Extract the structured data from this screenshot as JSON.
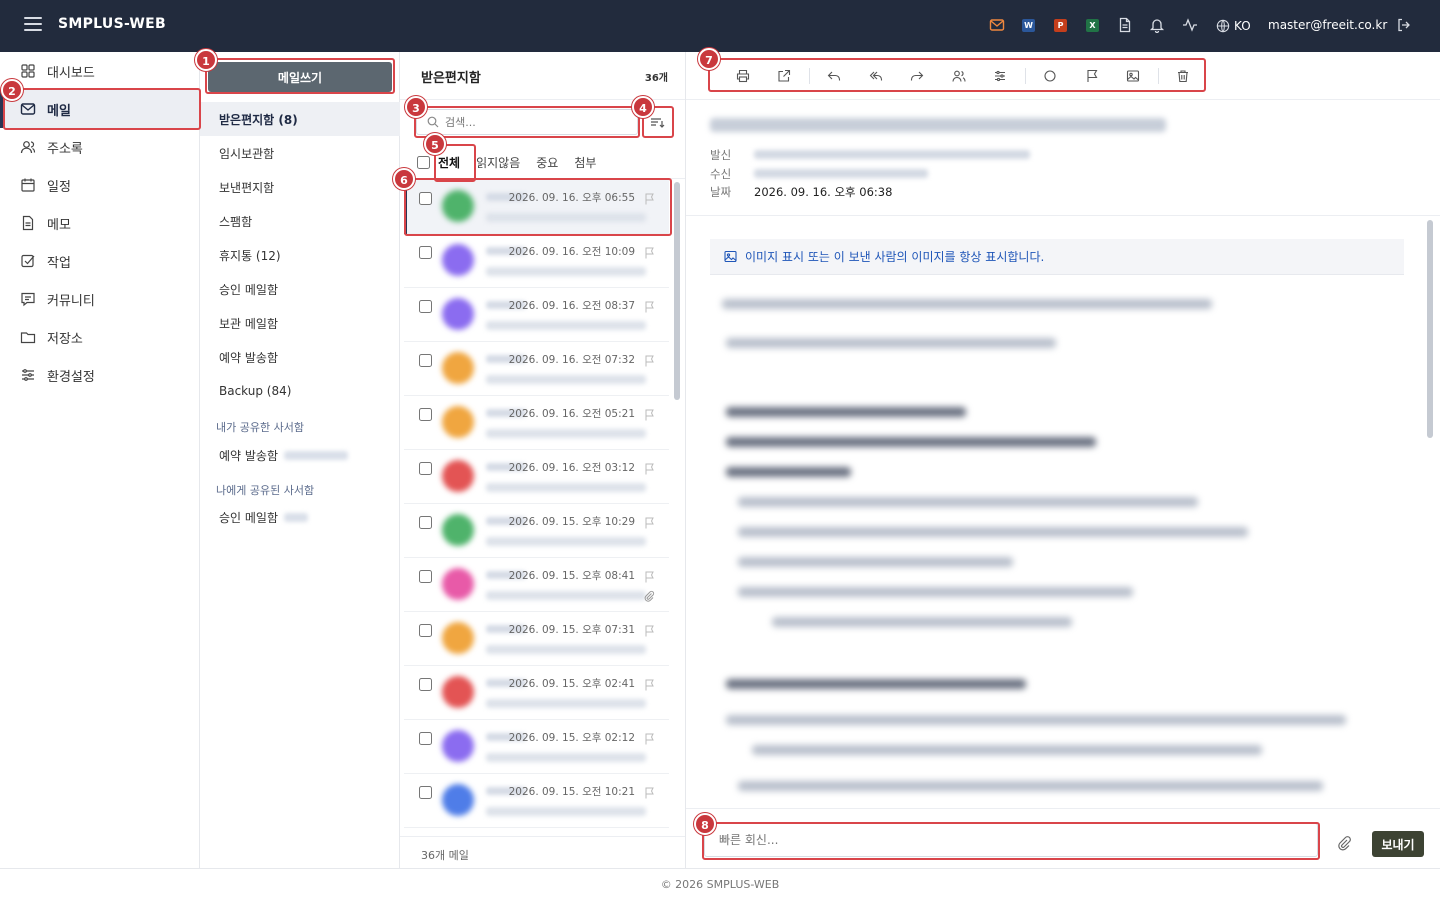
{
  "app": {
    "brand": "SMPLUS-WEB",
    "lang": "KO",
    "user_email": "master@freeit.co.kr",
    "footer": "© 2026 SMPLUS-WEB"
  },
  "topbar_icons": [
    "mail-icon",
    "word-icon",
    "powerpoint-icon",
    "excel-icon",
    "document-icon",
    "bell-icon",
    "activity-icon",
    "globe-icon",
    "logout-icon"
  ],
  "office_letters": {
    "word": "W",
    "powerpoint": "P",
    "excel": "X"
  },
  "colors": {
    "topbar": "#222b3d",
    "accent": "#2a3553",
    "annotation": "#d9454a",
    "word": "#2b579a",
    "powerpoint": "#c43e1c",
    "excel": "#217346",
    "mail_icon": "#f0883e"
  },
  "sidebar": {
    "items": [
      {
        "label": "대시보드",
        "icon": "grid-icon"
      },
      {
        "label": "메일",
        "icon": "mail-icon",
        "active": true
      },
      {
        "label": "주소록",
        "icon": "contacts-icon"
      },
      {
        "label": "일정",
        "icon": "calendar-icon"
      },
      {
        "label": "메모",
        "icon": "memo-icon"
      },
      {
        "label": "작업",
        "icon": "task-icon"
      },
      {
        "label": "커뮤니티",
        "icon": "community-icon"
      },
      {
        "label": "저장소",
        "icon": "folder-icon"
      },
      {
        "label": "환경설정",
        "icon": "settings-icon"
      }
    ]
  },
  "folders": {
    "compose_label": "메일쓰기",
    "items": [
      "받은편지함 (8)",
      "임시보관함",
      "보낸편지함",
      "스팸함",
      "휴지통 (12)",
      "승인 메일함",
      "보관 메일함",
      "예약 발송함",
      "Backup (84)"
    ],
    "shared_by_me_header": "내가 공유한 사서함",
    "shared_by_me_item": "예약 발송함",
    "shared_with_me_header": "나에게 공유된 사서함",
    "shared_with_me_item": "승인 메일함"
  },
  "message_list": {
    "title": "받은편지함",
    "count": "36개",
    "search_placeholder": "검색...",
    "tabs": [
      "전체",
      "읽지않음",
      "중요",
      "첨부"
    ],
    "footer": "36개 메일",
    "rows": [
      {
        "date": "2026. 09. 16. 오후 06:55",
        "avatar_color": "#4fb36b",
        "selected": true
      },
      {
        "date": "2026. 09. 16. 오전 10:09",
        "avatar_color": "#8b6cf0"
      },
      {
        "date": "2026. 09. 16. 오전 08:37",
        "avatar_color": "#8b6cf0"
      },
      {
        "date": "2026. 09. 16. 오전 07:32",
        "avatar_color": "#f0a640"
      },
      {
        "date": "2026. 09. 16. 오전 05:21",
        "avatar_color": "#f0a640"
      },
      {
        "date": "2026. 09. 16. 오전 03:12",
        "avatar_color": "#e35454"
      },
      {
        "date": "2026. 09. 15. 오후 10:29",
        "avatar_color": "#4fb36b"
      },
      {
        "date": "2026. 09. 15. 오후 08:41",
        "avatar_color": "#e85aa8",
        "attachment": true
      },
      {
        "date": "2026. 09. 15. 오후 07:31",
        "avatar_color": "#f0a640"
      },
      {
        "date": "2026. 09. 15. 오후 02:41",
        "avatar_color": "#e35454"
      },
      {
        "date": "2026. 09. 15. 오후 02:12",
        "avatar_color": "#8b6cf0"
      },
      {
        "date": "2026. 09. 15. 오전 10:21",
        "avatar_color": "#4f7de8"
      }
    ]
  },
  "reader": {
    "toolbar_icons": [
      "print-icon",
      "external-link-icon",
      "reply-icon",
      "reply-all-icon",
      "forward-icon",
      "people-icon",
      "filter-icon",
      "circle-icon",
      "flag-icon",
      "image-icon",
      "trash-icon"
    ],
    "from_label": "발신",
    "to_label": "수신",
    "date_label": "날짜",
    "date_value": "2026. 09. 16. 오후 06:38",
    "image_notice": "이미지 표시 또는 이 보낸 사람의 이미지를 항상 표시합니다.",
    "quick_reply_placeholder": "빠른 회신...",
    "send_label": "보내기"
  },
  "annotations": [
    "1",
    "2",
    "3",
    "4",
    "5",
    "6",
    "7",
    "8"
  ]
}
